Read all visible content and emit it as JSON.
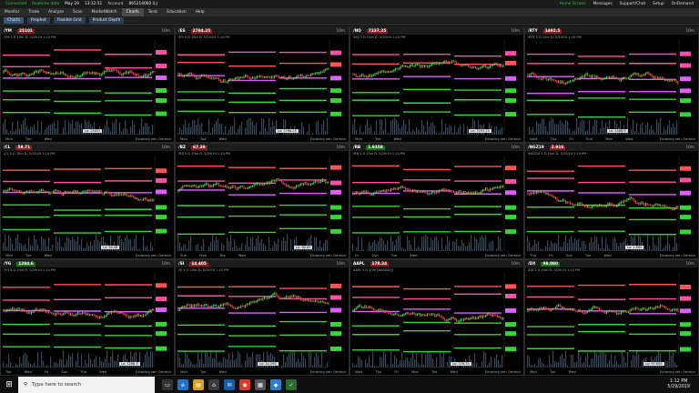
{
  "statusbar": {
    "connected": "Connected",
    "trading": "Realtime data",
    "date": "May 29",
    "time": "13:12:51",
    "account_label": "Account",
    "account_id": "865214060 (L)",
    "home": "Home Screen",
    "messages": "Messages",
    "support": "Support/Chat",
    "setup": "Setup",
    "ondemand": "OnDemand"
  },
  "menubar": {
    "tabs": [
      "Monitor",
      "Trade",
      "Analyze",
      "Scan",
      "MarketWatch",
      "Charts",
      "Tools",
      "Education",
      "Help"
    ],
    "active": "Charts"
  },
  "subtabs": [
    "Charts",
    "Prophet",
    "Flexible Grid",
    "Product Depth"
  ],
  "charts": [
    {
      "sym": "/YM",
      "price": "25101",
      "dir": "down",
      "tf": "10m",
      "info": "/YM 5 D 10m  D: 5/29/19 1:10 PM",
      "days": [
        "Mon",
        "Tue",
        "Wed"
      ],
      "lo": "Lo: 25057",
      "colors": [
        "#ff4fa8",
        "#ff4fa8",
        "#e060ff",
        "#36d636",
        "#36d636",
        "#36d636"
      ]
    },
    {
      "sym": "/ES",
      "price": "2784.25",
      "dir": "down",
      "tf": "10m",
      "info": "/ES 5 D 10m  D: 5/29/19 1:10 PM",
      "days": [
        "Mon",
        "Tue",
        "Wed"
      ],
      "lo": "Lo: 2766.25",
      "colors": [
        "#ff4fa8",
        "#ff5555",
        "#e060ff",
        "#36d636",
        "#36d636",
        "#36d636"
      ]
    },
    {
      "sym": "/NQ",
      "price": "7237.25",
      "dir": "down",
      "tf": "10m",
      "info": "/NQ 3 D 10m  D: 5/29/19 1:10 PM",
      "days": [
        "Mon",
        "Tue",
        "Wed"
      ],
      "lo": "Lo: 7193.25",
      "colors": [
        "#ff4fa8",
        "#ff5555",
        "#e060ff",
        "#36d636",
        "#36d636",
        "#36d636"
      ]
    },
    {
      "sym": "/RTY",
      "price": "1492.5",
      "dir": "down",
      "tf": "10m",
      "info": "/RTY 5 D 10m  D: 5/29/19 1:10 PM",
      "days": [
        "Wed",
        "Thu",
        "Fri",
        "Sun",
        "Mon",
        "Wed"
      ],
      "lo": "Lo: 1486.6",
      "colors": [
        "#ff4fa8",
        "#ff4fa8",
        "#e060ff",
        "#e060ff",
        "#36d636",
        "#36d636"
      ]
    },
    {
      "sym": "/CL",
      "price": "58.71",
      "dir": "down",
      "tf": "10m",
      "info": "/CL 5 D 10m  D: 5/29/19 1:10 PM",
      "days": [
        "Mon",
        "Tue",
        "Wed"
      ],
      "lo": "Lo: 56.88",
      "colors": [
        "#ff5555",
        "#ff4fa8",
        "#e060ff",
        "#36d636",
        "#36d636",
        "#36d636"
      ]
    },
    {
      "sym": "/BZ",
      "price": "67.39",
      "dir": "down",
      "tf": "10m",
      "info": "/BZ 5 D 10m  D: 5/29/19 1:10 PM",
      "days": [
        "Sun",
        "Mon",
        "Tue",
        "Wed"
      ],
      "lo": "Lo: 66.65",
      "colors": [
        "#ff5555",
        "#ff4fa8",
        "#e060ff",
        "#36d636",
        "#36d636",
        "#36d636"
      ]
    },
    {
      "sym": "/RB",
      "price": "1.9358",
      "dir": "up",
      "tf": "10m",
      "info": "/RB 5 D 10m  D: 5/29/19 1:10 PM",
      "days": [
        "Fri",
        "Sun",
        "Tue",
        "Wed"
      ],
      "lo": "",
      "colors": [
        "#ff5555",
        "#ff4fa8",
        "#e060ff",
        "#36d636",
        "#36d636",
        "#36d636"
      ]
    },
    {
      "sym": "/NGZ19",
      "price": "2.916",
      "dir": "down",
      "tf": "10m",
      "info": "/NGZ19 5 D 10m  D: 5/29/19 1:10 PM",
      "days": [
        "Thu",
        "Fri",
        "Sun",
        "Tue",
        "Wed"
      ],
      "lo": "Lo: 2.865",
      "colors": [
        "#ff5555",
        "#ff4fa8",
        "#e060ff",
        "#36d636",
        "#36d636",
        "#36d636"
      ]
    },
    {
      "sym": "/YG",
      "price": "1284.6",
      "dir": "up",
      "tf": "10m",
      "info": "/YG 5 D 10m  D: 5/29/19 1:10 PM",
      "days": [
        "Tue",
        "Wed",
        "Fri",
        "Sun",
        "Tue",
        "Wed"
      ],
      "lo": "Lo: 1268.3",
      "colors": [
        "#ff5555",
        "#ff4fa8",
        "#e060ff",
        "#36d636",
        "#36d636",
        "#36d636"
      ]
    },
    {
      "sym": "/SI",
      "price": "14.405",
      "dir": "down",
      "tf": "10m",
      "info": "/SI 5 D 10m  D: 5/29/19 1:10 PM",
      "days": [
        "Mon",
        "Tue",
        "Wed"
      ],
      "lo": "Lo: 14.295",
      "colors": [
        "#ff5555",
        "#ff4fa8",
        "#e060ff",
        "#36d636",
        "#36d636",
        "#36d636"
      ]
    },
    {
      "sym": "AAPL",
      "price": "178.24",
      "dir": "down",
      "tf": "10m",
      "info": "AAPL 5 D 10m [NASDAQ]",
      "days": [
        "Wed",
        "Thu",
        "Fri",
        "Mon",
        "Tue",
        "Wed"
      ],
      "lo": "Lo: 176.73",
      "colors": [
        "#ff5555",
        "#ff4fa8",
        "#e060ff",
        "#36d636",
        "#36d636",
        "#36d636"
      ]
    },
    {
      "sym": "/DX",
      "price": "98.080",
      "dir": "up",
      "tf": "10m",
      "info": "/DX 5 D 10m  D: 5/29/19 1:10 PM",
      "days": [
        "Mon",
        "Tue",
        "Wed"
      ],
      "lo": "Lo: 97.605",
      "colors": [
        "#ff5555",
        "#ff4fa8",
        "#e060ff",
        "#36d636",
        "#36d636",
        "#36d636"
      ]
    }
  ],
  "drawing_set": "Drawing set: Default",
  "taskbar": {
    "search_placeholder": "Type here to search",
    "time": "1:12 PM",
    "date": "5/29/2019"
  }
}
